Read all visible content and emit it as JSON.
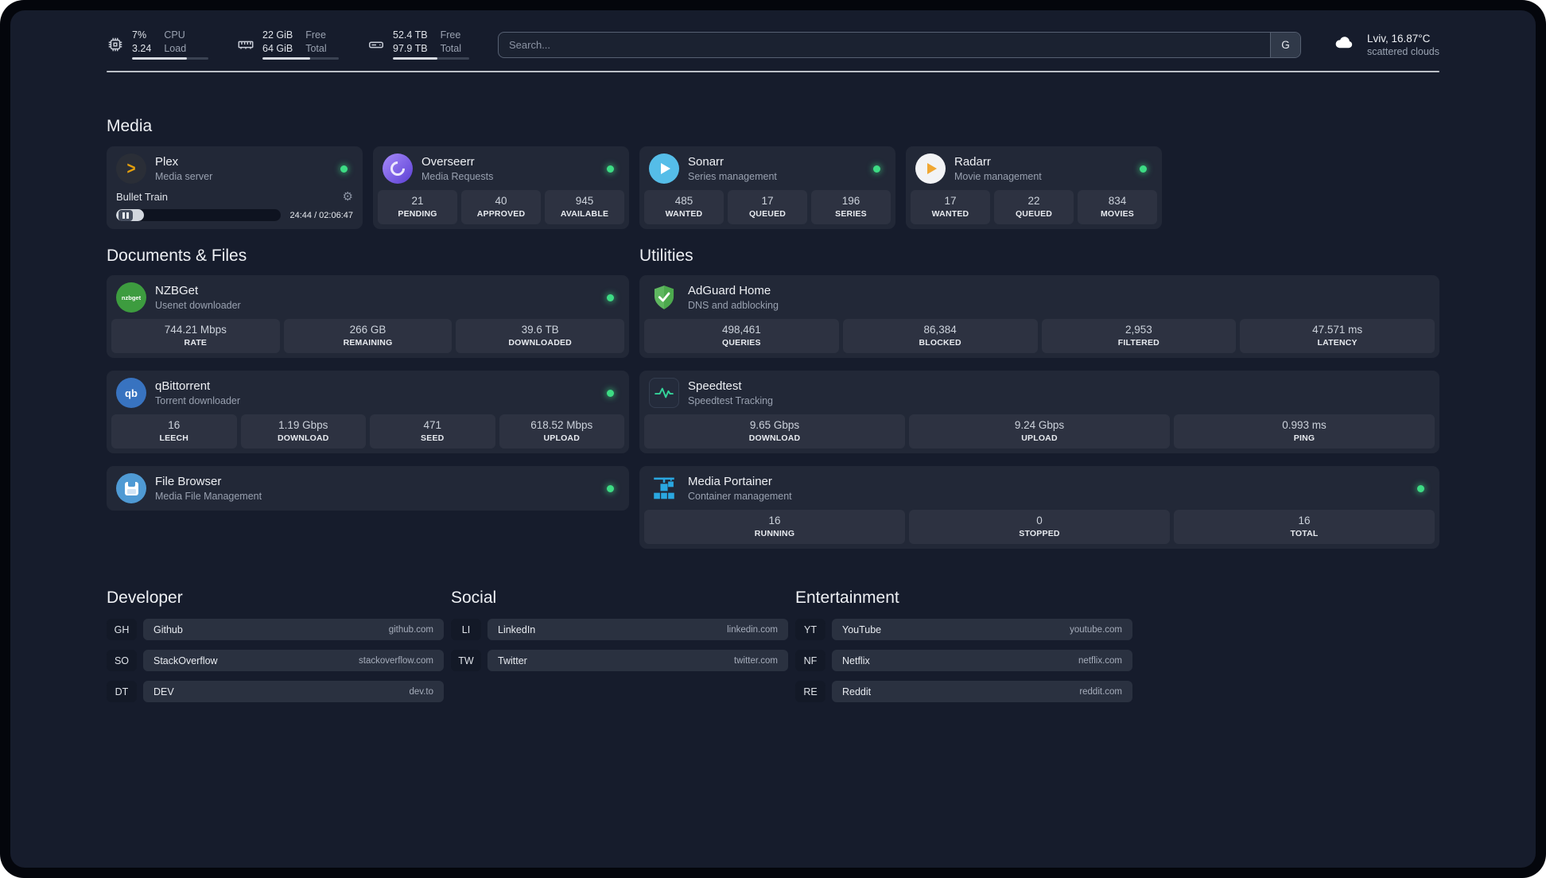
{
  "topbar": {
    "cpu": {
      "percent": "7%",
      "load": "3.24",
      "percent_label": "CPU",
      "load_label": "Load"
    },
    "memory": {
      "free": "22 GiB",
      "total": "64 GiB",
      "free_label": "Free",
      "total_label": "Total"
    },
    "disk": {
      "free": "52.4 TB",
      "total": "97.9 TB",
      "free_label": "Free",
      "total_label": "Total"
    },
    "search": {
      "placeholder": "Search...",
      "button": "G"
    },
    "weather": {
      "location": "Lviv, 16.87°C",
      "condition": "scattered clouds"
    }
  },
  "media": {
    "title": "Media",
    "cards": [
      {
        "name": "Plex",
        "desc": "Media server",
        "player": {
          "track": "Bullet Train",
          "time": "24:44 / 02:06:47"
        }
      },
      {
        "name": "Overseerr",
        "desc": "Media Requests",
        "stats": [
          {
            "value": "21",
            "label": "PENDING"
          },
          {
            "value": "40",
            "label": "APPROVED"
          },
          {
            "value": "945",
            "label": "AVAILABLE"
          }
        ]
      },
      {
        "name": "Sonarr",
        "desc": "Series management",
        "stats": [
          {
            "value": "485",
            "label": "WANTED"
          },
          {
            "value": "17",
            "label": "QUEUED"
          },
          {
            "value": "196",
            "label": "SERIES"
          }
        ]
      },
      {
        "name": "Radarr",
        "desc": "Movie management",
        "stats": [
          {
            "value": "17",
            "label": "WANTED"
          },
          {
            "value": "22",
            "label": "QUEUED"
          },
          {
            "value": "834",
            "label": "MOVIES"
          }
        ]
      }
    ]
  },
  "documents": {
    "title": "Documents & Files",
    "cards": [
      {
        "name": "NZBGet",
        "desc": "Usenet downloader",
        "stats": [
          {
            "value": "744.21 Mbps",
            "label": "RATE"
          },
          {
            "value": "266 GB",
            "label": "REMAINING"
          },
          {
            "value": "39.6 TB",
            "label": "DOWNLOADED"
          }
        ]
      },
      {
        "name": "qBittorrent",
        "desc": "Torrent downloader",
        "stats": [
          {
            "value": "16",
            "label": "LEECH"
          },
          {
            "value": "1.19 Gbps",
            "label": "DOWNLOAD"
          },
          {
            "value": "471",
            "label": "SEED"
          },
          {
            "value": "618.52 Mbps",
            "label": "UPLOAD"
          }
        ]
      },
      {
        "name": "File Browser",
        "desc": "Media File Management"
      }
    ]
  },
  "utilities": {
    "title": "Utilities",
    "cards": [
      {
        "name": "AdGuard Home",
        "desc": "DNS and adblocking",
        "stats": [
          {
            "value": "498,461",
            "label": "QUERIES"
          },
          {
            "value": "86,384",
            "label": "BLOCKED"
          },
          {
            "value": "2,953",
            "label": "FILTERED"
          },
          {
            "value": "47.571 ms",
            "label": "LATENCY"
          }
        ]
      },
      {
        "name": "Speedtest",
        "desc": "Speedtest Tracking",
        "stats": [
          {
            "value": "9.65 Gbps",
            "label": "DOWNLOAD"
          },
          {
            "value": "9.24 Gbps",
            "label": "UPLOAD"
          },
          {
            "value": "0.993 ms",
            "label": "PING"
          }
        ]
      },
      {
        "name": "Media Portainer",
        "desc": "Container management",
        "stats": [
          {
            "value": "16",
            "label": "RUNNING"
          },
          {
            "value": "0",
            "label": "STOPPED"
          },
          {
            "value": "16",
            "label": "TOTAL"
          }
        ]
      }
    ]
  },
  "bookmarks": {
    "groups": [
      {
        "title": "Developer",
        "items": [
          {
            "abbr": "GH",
            "name": "Github",
            "url": "github.com"
          },
          {
            "abbr": "SO",
            "name": "StackOverflow",
            "url": "stackoverflow.com"
          },
          {
            "abbr": "DT",
            "name": "DEV",
            "url": "dev.to"
          }
        ]
      },
      {
        "title": "Social",
        "items": [
          {
            "abbr": "LI",
            "name": "LinkedIn",
            "url": "linkedin.com"
          },
          {
            "abbr": "TW",
            "name": "Twitter",
            "url": "twitter.com"
          }
        ]
      },
      {
        "title": "Entertainment",
        "items": [
          {
            "abbr": "YT",
            "name": "YouTube",
            "url": "youtube.com"
          },
          {
            "abbr": "NF",
            "name": "Netflix",
            "url": "netflix.com"
          },
          {
            "abbr": "RE",
            "name": "Reddit",
            "url": "reddit.com"
          }
        ]
      }
    ]
  },
  "icons": {
    "plex_glyph": ">",
    "nzbget_text": "nzbget",
    "qbittorrent_text": "qb",
    "gear_glyph": "⚙"
  },
  "colors": {
    "status_online": "#3ddc84",
    "background": "#161c2c",
    "card": "#212a3b",
    "plex_accent": "#e5a00d"
  }
}
